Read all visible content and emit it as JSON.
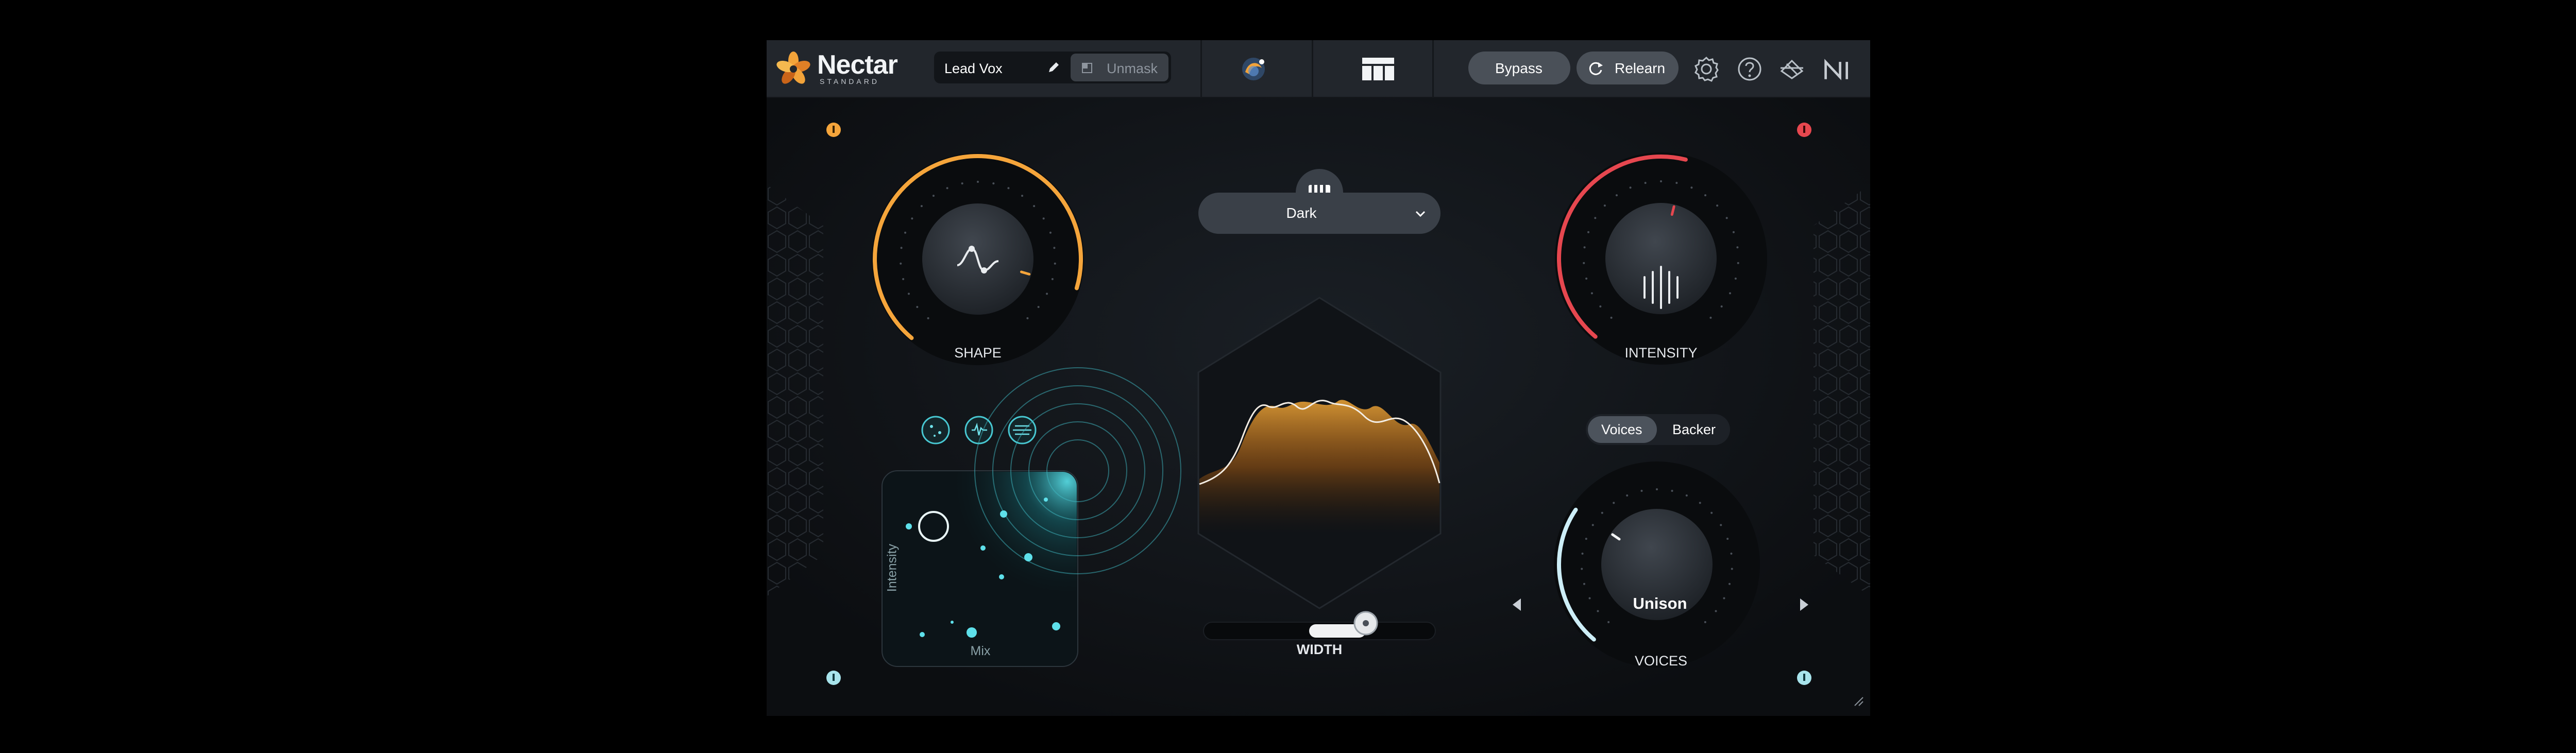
{
  "header": {
    "brand_name": "Nectar",
    "brand_edition": "STANDARD",
    "preset_name": "Lead Vox",
    "unmask_label": "Unmask",
    "bypass_label": "Bypass",
    "relearn_label": "Relearn",
    "icons": [
      "flower-logo-icon",
      "pencil-icon",
      "unmask-icon",
      "assistant-orb-icon",
      "modules-grid-icon",
      "relearn-cycle-icon",
      "gear-icon",
      "help-icon",
      "routing-icon",
      "ni-logo-icon"
    ]
  },
  "shape": {
    "label": "SHAPE",
    "level": 0.88,
    "color": "#f5a53b"
  },
  "intensity": {
    "label": "INTENSITY",
    "level": 0.55,
    "color": "#e6474f"
  },
  "piano": {
    "icon": "piano-keys-icon"
  },
  "style_dropdown": {
    "selected": "Dark"
  },
  "spectrum": {
    "label": "WIDTH",
    "width_level": 0.7
  },
  "voices_mode": {
    "options": [
      "Voices",
      "Backer"
    ],
    "selected": "Voices"
  },
  "voices": {
    "label": "VOICES",
    "value": "Unison",
    "level": 0.3,
    "color": "#cdeef7"
  },
  "xy_pad": {
    "x_label": "Mix",
    "y_label": "Intensity",
    "mode_icons": [
      "sparse-icon",
      "pulse-icon",
      "wave-icon"
    ]
  },
  "colors": {
    "panel": "#0f1216",
    "header": "#22262c",
    "orange": "#f5a53b",
    "red": "#e6474f",
    "teal": "#48c8d2"
  }
}
